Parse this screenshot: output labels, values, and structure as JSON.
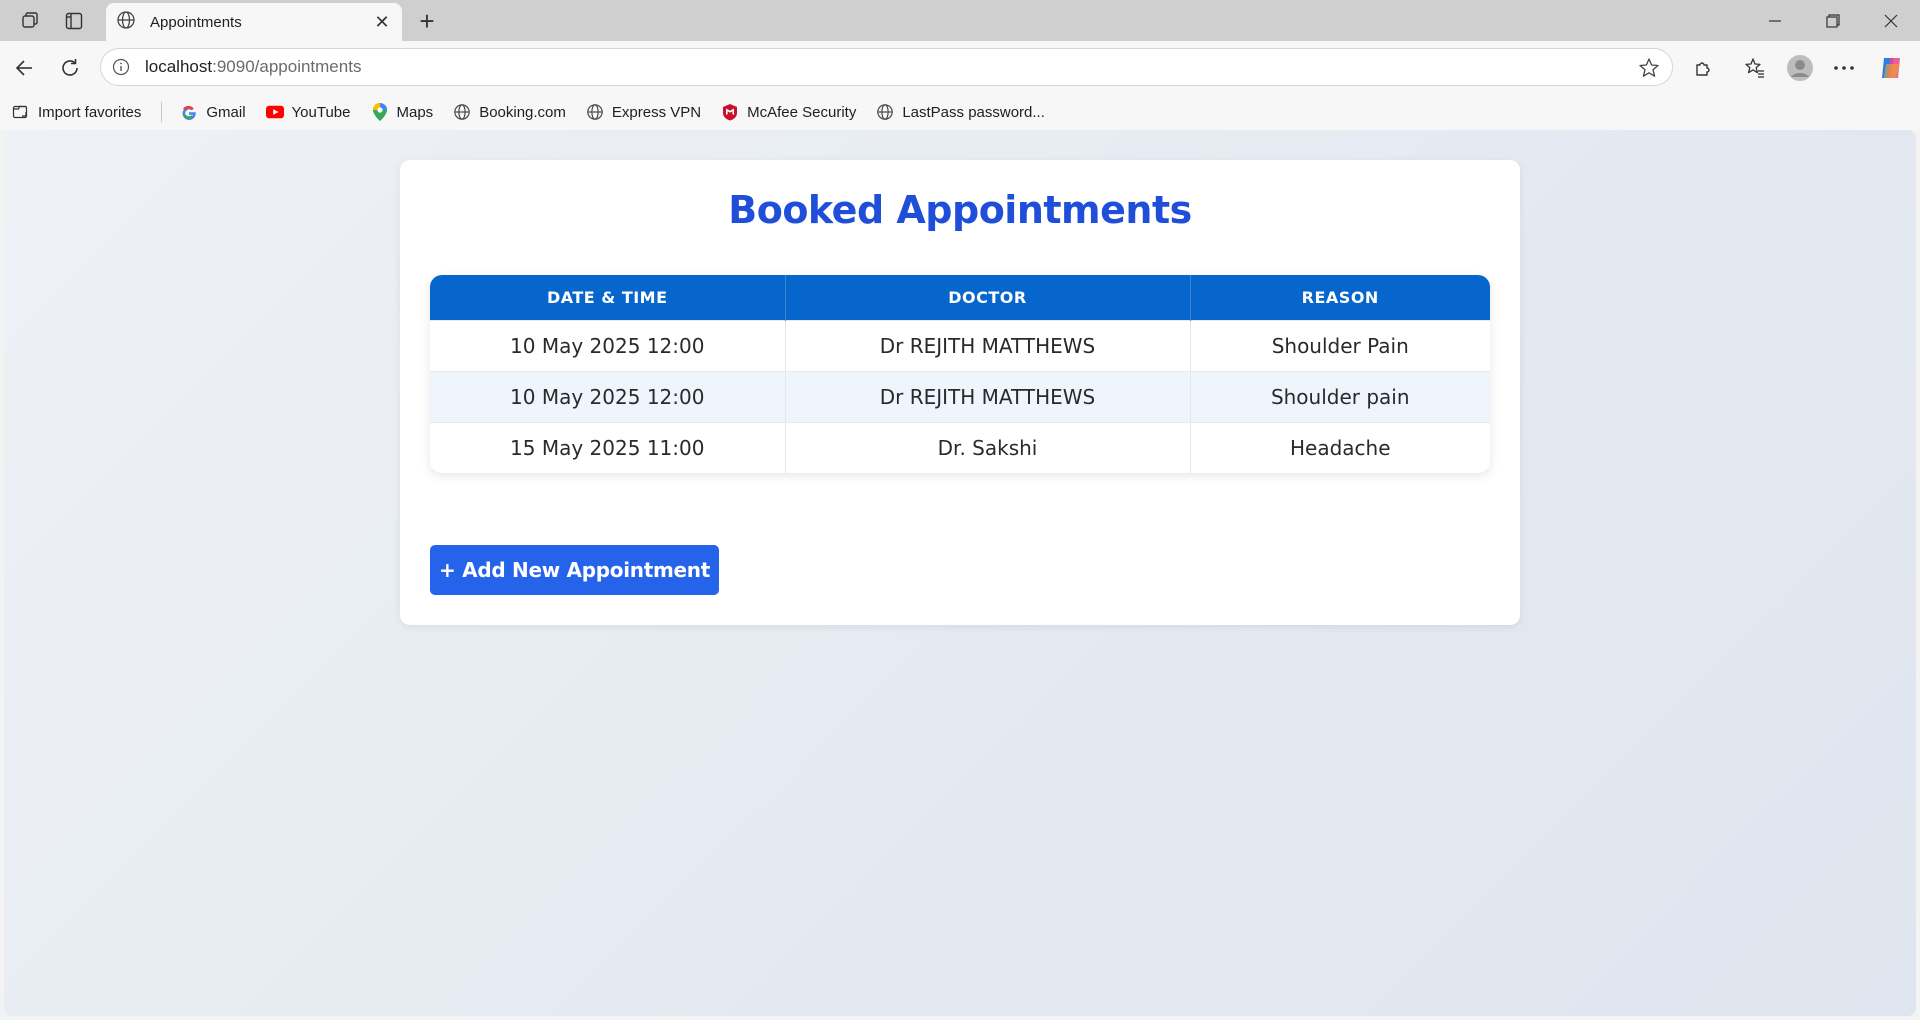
{
  "browser": {
    "tab_title": "Appointments",
    "url_host": "localhost",
    "url_path": ":9090/appointments",
    "bookmarks": [
      {
        "label": "Import favorites",
        "icon": "import-icon"
      },
      {
        "label": "Gmail",
        "icon": "google-icon"
      },
      {
        "label": "YouTube",
        "icon": "youtube-icon"
      },
      {
        "label": "Maps",
        "icon": "maps-pin-icon"
      },
      {
        "label": "Booking.com",
        "icon": "globe-icon"
      },
      {
        "label": "Express VPN",
        "icon": "globe-icon"
      },
      {
        "label": "McAfee Security",
        "icon": "mcafee-icon"
      },
      {
        "label": "LastPass password...",
        "icon": "globe-icon"
      }
    ]
  },
  "page": {
    "title": "Booked Appointments",
    "table": {
      "headers": [
        "DATE & TIME",
        "DOCTOR",
        "REASON"
      ],
      "rows": [
        [
          "10 May 2025 12:00",
          "Dr REJITH MATTHEWS",
          "Shoulder Pain"
        ],
        [
          "10 May 2025 12:00",
          "Dr REJITH MATTHEWS",
          "Shoulder pain"
        ],
        [
          "15 May 2025 11:00",
          "Dr. Sakshi",
          "Headache"
        ]
      ]
    },
    "add_button_label": "+ Add New Appointment"
  },
  "colors": {
    "accent": "#1f4ed8",
    "table_header": "#0766cc",
    "button": "#2563eb",
    "alt_row": "#eef5fd"
  }
}
